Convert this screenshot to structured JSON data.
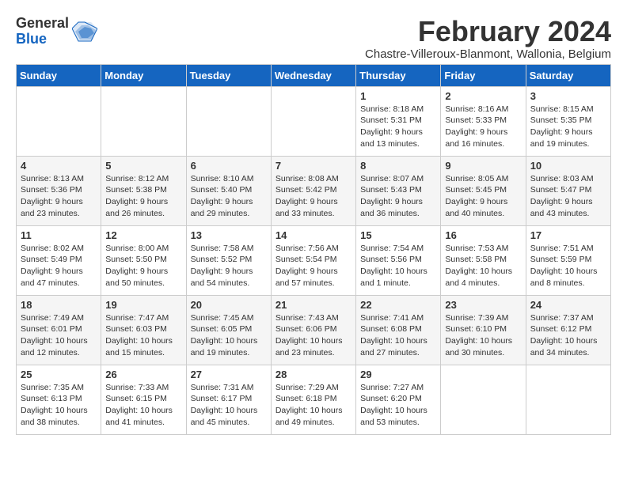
{
  "logo": {
    "general": "General",
    "blue": "Blue"
  },
  "title": "February 2024",
  "subtitle": "Chastre-Villeroux-Blanmont, Wallonia, Belgium",
  "headers": [
    "Sunday",
    "Monday",
    "Tuesday",
    "Wednesday",
    "Thursday",
    "Friday",
    "Saturday"
  ],
  "weeks": [
    [
      {
        "day": "",
        "info": ""
      },
      {
        "day": "",
        "info": ""
      },
      {
        "day": "",
        "info": ""
      },
      {
        "day": "",
        "info": ""
      },
      {
        "day": "1",
        "info": "Sunrise: 8:18 AM\nSunset: 5:31 PM\nDaylight: 9 hours\nand 13 minutes."
      },
      {
        "day": "2",
        "info": "Sunrise: 8:16 AM\nSunset: 5:33 PM\nDaylight: 9 hours\nand 16 minutes."
      },
      {
        "day": "3",
        "info": "Sunrise: 8:15 AM\nSunset: 5:35 PM\nDaylight: 9 hours\nand 19 minutes."
      }
    ],
    [
      {
        "day": "4",
        "info": "Sunrise: 8:13 AM\nSunset: 5:36 PM\nDaylight: 9 hours\nand 23 minutes."
      },
      {
        "day": "5",
        "info": "Sunrise: 8:12 AM\nSunset: 5:38 PM\nDaylight: 9 hours\nand 26 minutes."
      },
      {
        "day": "6",
        "info": "Sunrise: 8:10 AM\nSunset: 5:40 PM\nDaylight: 9 hours\nand 29 minutes."
      },
      {
        "day": "7",
        "info": "Sunrise: 8:08 AM\nSunset: 5:42 PM\nDaylight: 9 hours\nand 33 minutes."
      },
      {
        "day": "8",
        "info": "Sunrise: 8:07 AM\nSunset: 5:43 PM\nDaylight: 9 hours\nand 36 minutes."
      },
      {
        "day": "9",
        "info": "Sunrise: 8:05 AM\nSunset: 5:45 PM\nDaylight: 9 hours\nand 40 minutes."
      },
      {
        "day": "10",
        "info": "Sunrise: 8:03 AM\nSunset: 5:47 PM\nDaylight: 9 hours\nand 43 minutes."
      }
    ],
    [
      {
        "day": "11",
        "info": "Sunrise: 8:02 AM\nSunset: 5:49 PM\nDaylight: 9 hours\nand 47 minutes."
      },
      {
        "day": "12",
        "info": "Sunrise: 8:00 AM\nSunset: 5:50 PM\nDaylight: 9 hours\nand 50 minutes."
      },
      {
        "day": "13",
        "info": "Sunrise: 7:58 AM\nSunset: 5:52 PM\nDaylight: 9 hours\nand 54 minutes."
      },
      {
        "day": "14",
        "info": "Sunrise: 7:56 AM\nSunset: 5:54 PM\nDaylight: 9 hours\nand 57 minutes."
      },
      {
        "day": "15",
        "info": "Sunrise: 7:54 AM\nSunset: 5:56 PM\nDaylight: 10 hours\nand 1 minute."
      },
      {
        "day": "16",
        "info": "Sunrise: 7:53 AM\nSunset: 5:58 PM\nDaylight: 10 hours\nand 4 minutes."
      },
      {
        "day": "17",
        "info": "Sunrise: 7:51 AM\nSunset: 5:59 PM\nDaylight: 10 hours\nand 8 minutes."
      }
    ],
    [
      {
        "day": "18",
        "info": "Sunrise: 7:49 AM\nSunset: 6:01 PM\nDaylight: 10 hours\nand 12 minutes."
      },
      {
        "day": "19",
        "info": "Sunrise: 7:47 AM\nSunset: 6:03 PM\nDaylight: 10 hours\nand 15 minutes."
      },
      {
        "day": "20",
        "info": "Sunrise: 7:45 AM\nSunset: 6:05 PM\nDaylight: 10 hours\nand 19 minutes."
      },
      {
        "day": "21",
        "info": "Sunrise: 7:43 AM\nSunset: 6:06 PM\nDaylight: 10 hours\nand 23 minutes."
      },
      {
        "day": "22",
        "info": "Sunrise: 7:41 AM\nSunset: 6:08 PM\nDaylight: 10 hours\nand 27 minutes."
      },
      {
        "day": "23",
        "info": "Sunrise: 7:39 AM\nSunset: 6:10 PM\nDaylight: 10 hours\nand 30 minutes."
      },
      {
        "day": "24",
        "info": "Sunrise: 7:37 AM\nSunset: 6:12 PM\nDaylight: 10 hours\nand 34 minutes."
      }
    ],
    [
      {
        "day": "25",
        "info": "Sunrise: 7:35 AM\nSunset: 6:13 PM\nDaylight: 10 hours\nand 38 minutes."
      },
      {
        "day": "26",
        "info": "Sunrise: 7:33 AM\nSunset: 6:15 PM\nDaylight: 10 hours\nand 41 minutes."
      },
      {
        "day": "27",
        "info": "Sunrise: 7:31 AM\nSunset: 6:17 PM\nDaylight: 10 hours\nand 45 minutes."
      },
      {
        "day": "28",
        "info": "Sunrise: 7:29 AM\nSunset: 6:18 PM\nDaylight: 10 hours\nand 49 minutes."
      },
      {
        "day": "29",
        "info": "Sunrise: 7:27 AM\nSunset: 6:20 PM\nDaylight: 10 hours\nand 53 minutes."
      },
      {
        "day": "",
        "info": ""
      },
      {
        "day": "",
        "info": ""
      }
    ]
  ]
}
